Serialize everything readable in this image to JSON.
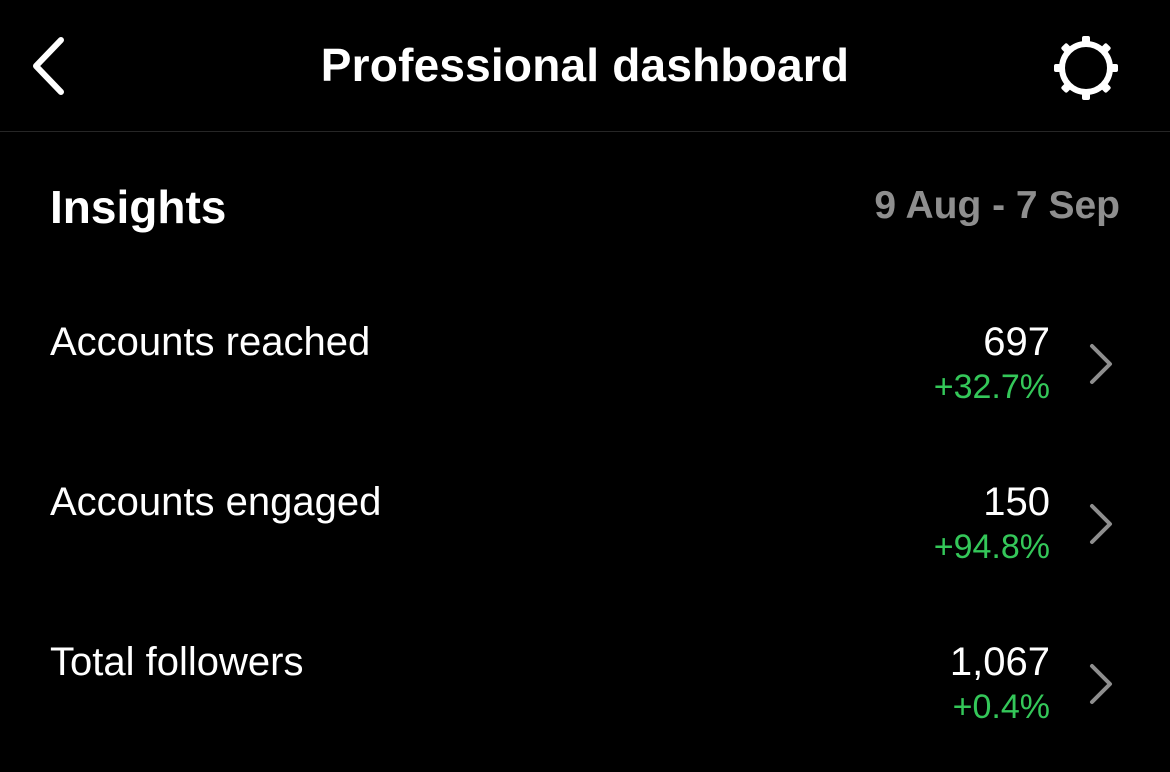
{
  "header": {
    "title": "Professional dashboard",
    "back_icon": "chevron-left-icon",
    "settings_icon": "gear-icon"
  },
  "insights": {
    "title": "Insights",
    "date_range": "9 Aug - 7 Sep",
    "metrics": [
      {
        "label": "Accounts reached",
        "value": "697",
        "change": "+32.7%"
      },
      {
        "label": "Accounts engaged",
        "value": "150",
        "change": "+94.8%"
      },
      {
        "label": "Total followers",
        "value": "1,067",
        "change": "+0.4%"
      }
    ]
  },
  "colors": {
    "background": "#000000",
    "text": "#ffffff",
    "muted": "#8e8e8e",
    "positive": "#34c759",
    "chevron": "#8e8e8e"
  }
}
